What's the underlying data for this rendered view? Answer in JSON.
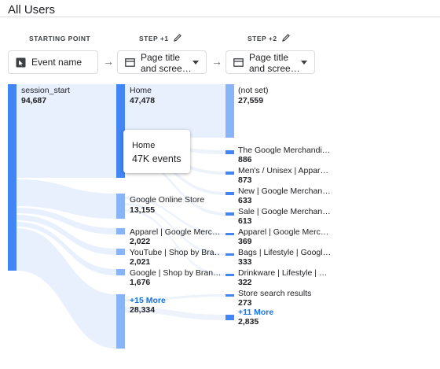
{
  "header": {
    "title": "All Users"
  },
  "columns": {
    "start": {
      "label": "STARTING POINT",
      "picker": "Event name"
    },
    "step1": {
      "label": "STEP +1",
      "picker_line1": "Page title",
      "picker_line2": "and scree…"
    },
    "step2": {
      "label": "STEP +2",
      "picker_line1": "Page title",
      "picker_line2": "and scree…"
    }
  },
  "start_nodes": [
    {
      "name": "session_start",
      "value": "94,687"
    }
  ],
  "step1_nodes": [
    {
      "name": "Home",
      "value": "47,478"
    },
    {
      "name": "Google Online Store",
      "value": "13,155"
    },
    {
      "name": "Apparel | Google Merc…",
      "value": "2,022"
    },
    {
      "name": "YouTube | Shop by Bra…",
      "value": "2,021"
    },
    {
      "name": "Google | Shop by Bran…",
      "value": "1,676"
    },
    {
      "name": "+15 More",
      "value": "28,334"
    }
  ],
  "step2_nodes": [
    {
      "name": "(not set)",
      "value": "27,559"
    },
    {
      "name": "The Google Merchandi…",
      "value": "886"
    },
    {
      "name": "Men's / Unisex | Appar…",
      "value": "873"
    },
    {
      "name": "New | Google Merchan…",
      "value": "633"
    },
    {
      "name": "Sale | Google Merchan…",
      "value": "613"
    },
    {
      "name": "Apparel | Google Merc…",
      "value": "369"
    },
    {
      "name": "Bags | Lifestyle | Googl…",
      "value": "333"
    },
    {
      "name": "Drinkware | Lifestyle | …",
      "value": "322"
    },
    {
      "name": "Store search results",
      "value": "273"
    },
    {
      "name": "+11 More",
      "value": "2,835"
    }
  ],
  "tooltip": {
    "title": "Home",
    "value": "47K events"
  },
  "colors": {
    "node": "#4285f4",
    "node_light": "#8ab4f8",
    "flow": "#e8f0fe",
    "link": "#1a73e8"
  },
  "icons": {
    "event": "cursor-icon",
    "page": "table-icon",
    "edit": "pencil-icon"
  }
}
